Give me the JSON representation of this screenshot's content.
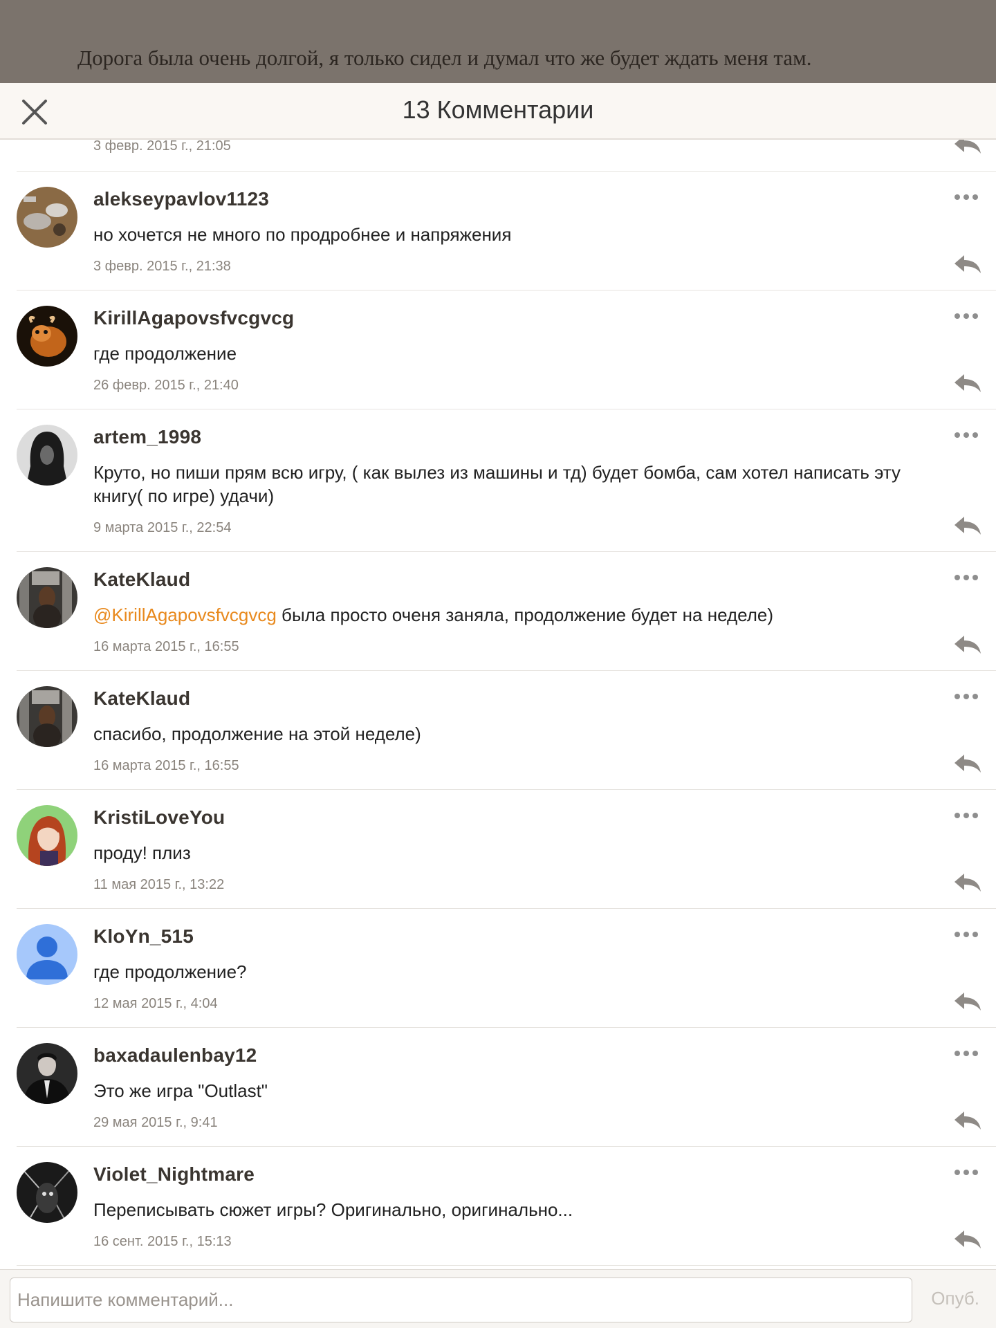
{
  "story": {
    "text": "Дорога была очень долгой, я только сидел и думал что же будет ждать меня там."
  },
  "header": {
    "title": "13 Комментарии"
  },
  "partial_comment": {
    "time": "3 февр. 2015 г., 21:05"
  },
  "comments": [
    {
      "user": "alekseypavlov1123",
      "text": "но хочется не много по продробнее и напряжения",
      "time": "3 февр. 2015 г., 21:38",
      "avatar": "cat-photo-avatar"
    },
    {
      "user": "KirillAgapovsfvcgvcg",
      "text": "где продолжение",
      "time": "26 февр. 2015 г., 21:40",
      "avatar": "cartoon-creature-avatar"
    },
    {
      "user": "artem_1998",
      "text": "Круто, но пиши прям всю игру, ( как вылез из машины и тд) будет бомба, сам хотел написать эту книгу( по игре) удачи)",
      "time": "9 марта 2015 г., 22:54",
      "avatar": "hooded-figure-avatar"
    },
    {
      "user": "KateKlaud",
      "mention": "@KirillAgapovsfvcgvcg",
      "text": " была просто оченя заняла, продолжение будет на неделе)",
      "time": "16 марта 2015 г., 16:55",
      "avatar": "girl-city-avatar"
    },
    {
      "user": "KateKlaud",
      "text": "спасибо, продолжение на этой неделе)",
      "time": "16 марта 2015 г., 16:55",
      "avatar": "girl-city-avatar"
    },
    {
      "user": "KristiLoveYou",
      "text": "проду! плиз",
      "time": "11 мая 2015 г., 13:22",
      "avatar": "anime-girl-avatar"
    },
    {
      "user": "KloYn_515",
      "text": "где продолжение?",
      "time": "12 мая 2015 г., 4:04",
      "avatar": "default-person-avatar"
    },
    {
      "user": "baxadaulenbay12",
      "text": "Это же игра \"Outlast\"",
      "time": "29 мая 2015 г., 9:41",
      "avatar": "man-in-suit-avatar"
    },
    {
      "user": "Violet_Nightmare",
      "text": "Переписывать сюжет игры? Оригинально, оригинально...",
      "time": "16 сент. 2015 г., 15:13",
      "avatar": "dark-art-avatar"
    }
  ],
  "input": {
    "placeholder": "Напишите комментарий...",
    "publish_label": "Опуб."
  },
  "colors": {
    "mention": "#e8891d",
    "header_bg": "#faf7f3",
    "story_bg": "#7b736c"
  }
}
